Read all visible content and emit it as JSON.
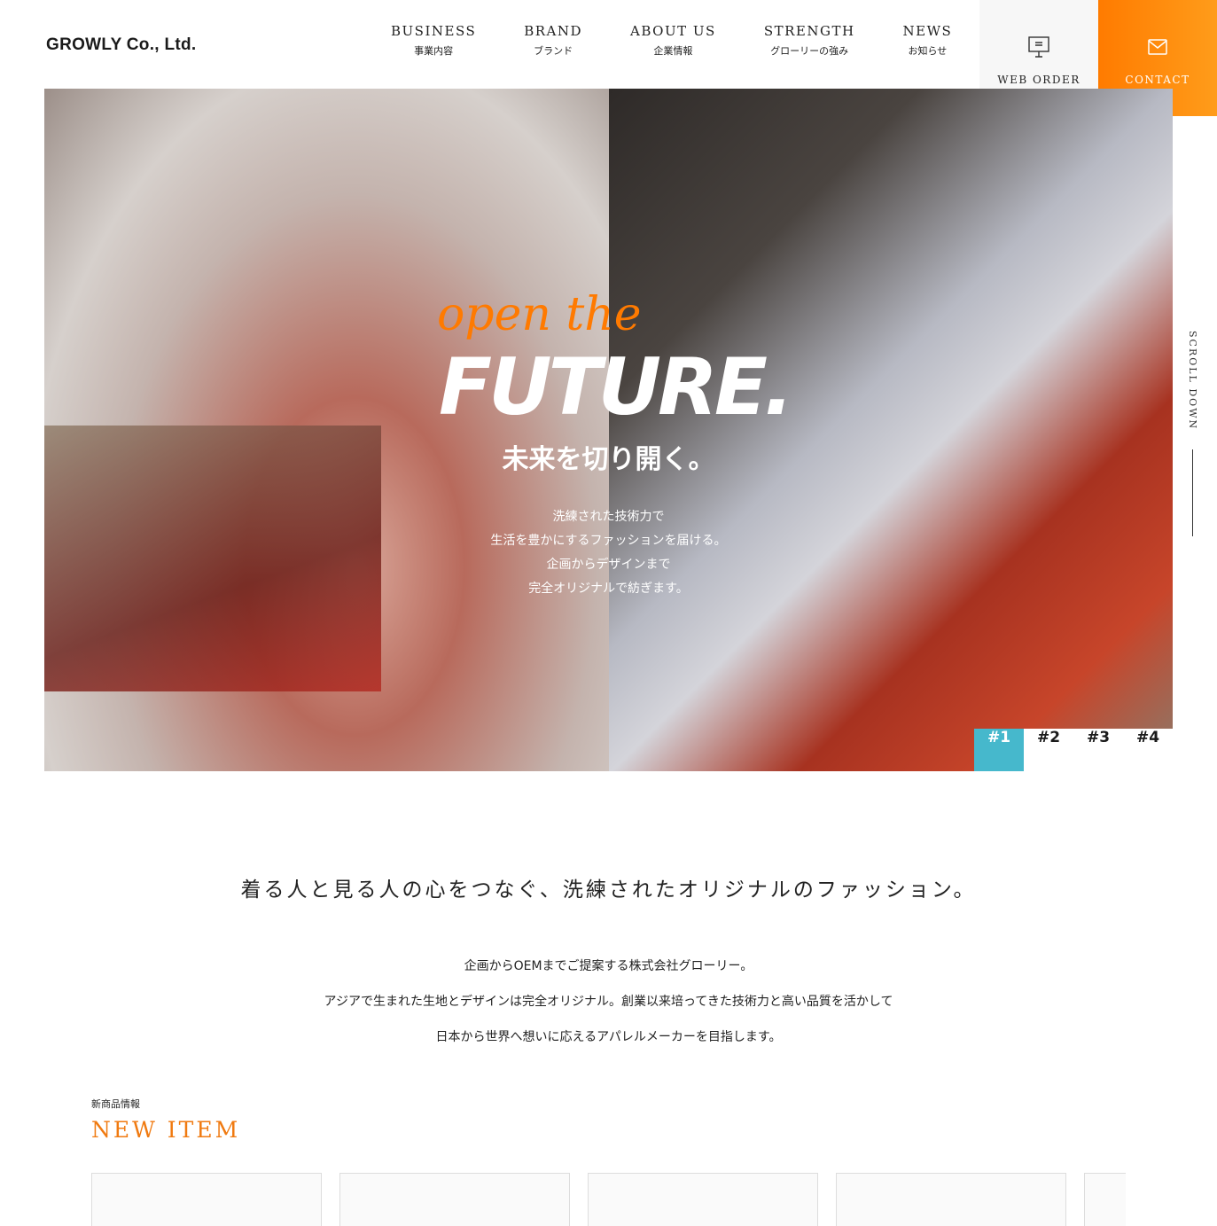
{
  "header": {
    "logo": "GROWLY Co., Ltd.",
    "nav": [
      {
        "en": "BUSINESS",
        "jp": "事業内容"
      },
      {
        "en": "BRAND",
        "jp": "ブランド"
      },
      {
        "en": "ABOUT US",
        "jp": "企業情報"
      },
      {
        "en": "STRENGTH",
        "jp": "グローリーの強み"
      },
      {
        "en": "NEWS",
        "jp": "お知らせ"
      }
    ],
    "web_order": {
      "label": "WEB ORDER",
      "icon": "monitor-icon"
    },
    "contact": {
      "label": "CONTACT",
      "icon": "mail-icon"
    }
  },
  "hero": {
    "open": "open the",
    "future": "FUTURE.",
    "catch": "未来を切り開く。",
    "lines": [
      "洗練された技術力で",
      "生活を豊かにするファッションを届ける。",
      "企画からデザインまで",
      "完全オリジナルで紡ぎます。"
    ],
    "slides": [
      "#1",
      "#2",
      "#3",
      "#4"
    ],
    "active_slide": "#1",
    "scroll": "SCROLL DOWN"
  },
  "intro": {
    "tagline": "着る人と見る人の心をつなぐ、洗練されたオリジナルのファッション。",
    "lines": [
      "企画からOEMまでご提案する株式会社グローリー。",
      "アジアで生まれた生地とデザインは完全オリジナル。創業以来培ってきた技術力と高い品質を活かして",
      "日本から世界へ想いに応えるアパレルメーカーを目指します。"
    ]
  },
  "new_item": {
    "jp": "新商品情報",
    "en": "NEW ITEM"
  },
  "colors": {
    "accent": "#ff7a00",
    "slide_active": "#46b8cc"
  }
}
